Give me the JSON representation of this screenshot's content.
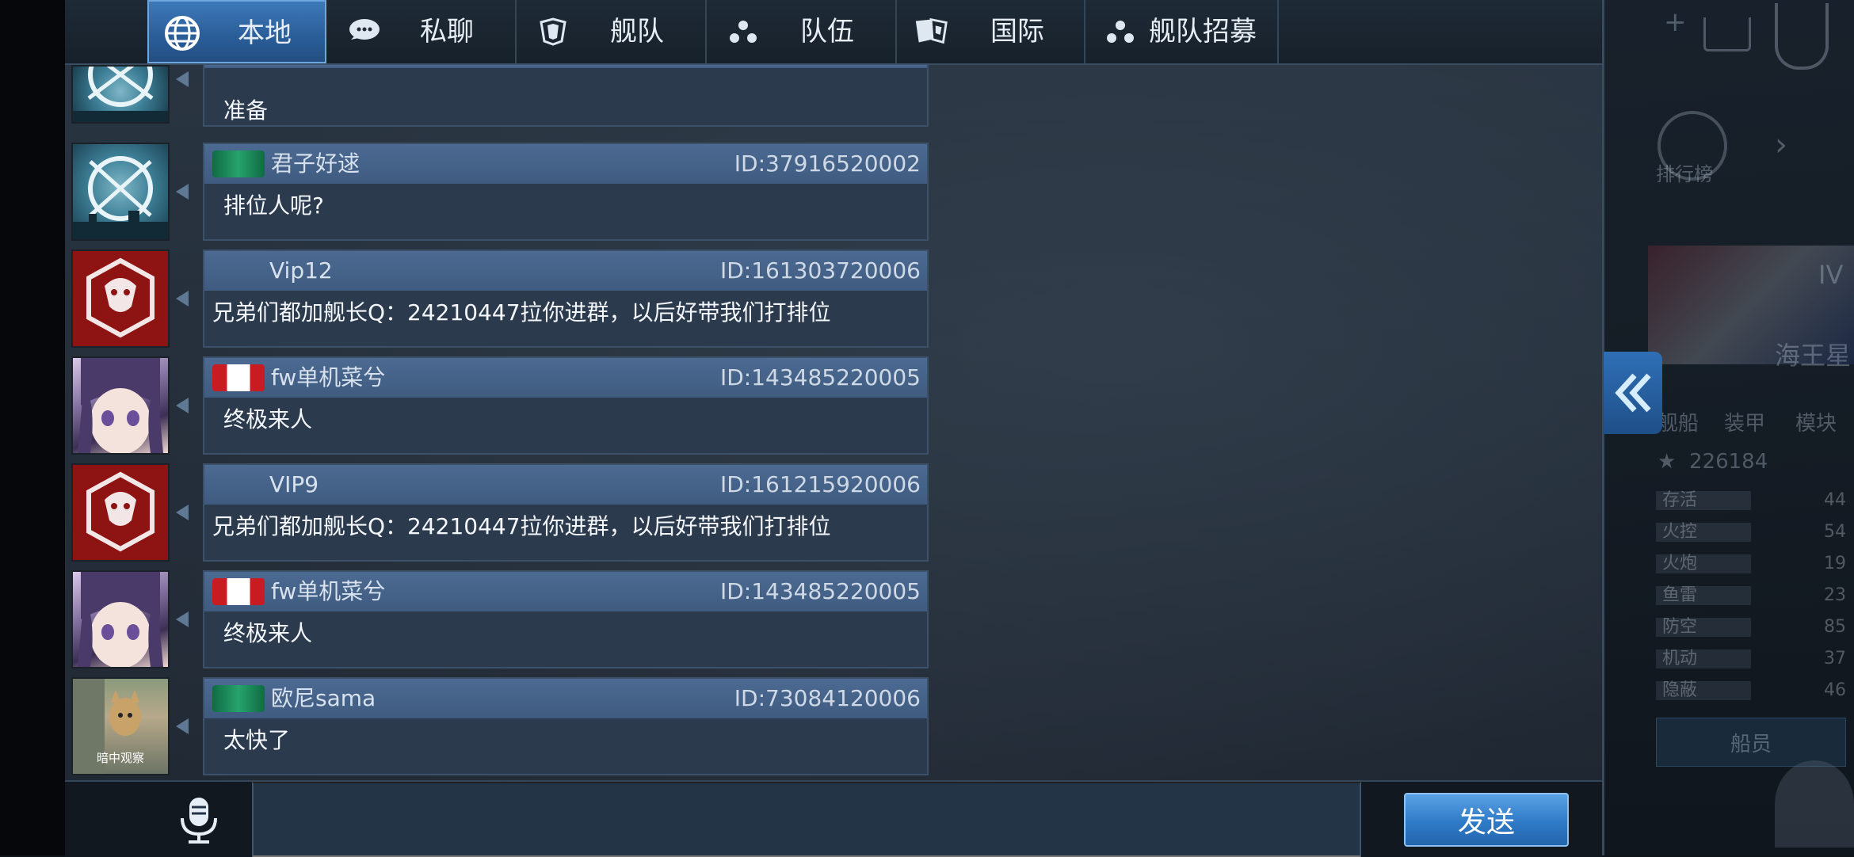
{
  "tabs": [
    {
      "label": "本地",
      "icon": "globe-icon",
      "active": true
    },
    {
      "label": "私聊",
      "icon": "chat-bubble-icon",
      "active": false
    },
    {
      "label": "舰队",
      "icon": "fleet-icon",
      "active": false
    },
    {
      "label": "队伍",
      "icon": "team-icon",
      "active": false
    },
    {
      "label": "国际",
      "icon": "flags-icon",
      "active": false
    },
    {
      "label": "舰队招募",
      "icon": "team-icon",
      "active": false
    }
  ],
  "messages": [
    {
      "name": "",
      "id": "",
      "text": "准备",
      "avatar": "naval-emblem",
      "flag": ""
    },
    {
      "name": "君子好逑",
      "id": "ID:37916520002",
      "text": "排位人呢?",
      "avatar": "naval-emblem",
      "flag": "green"
    },
    {
      "name": "Vip12",
      "id": "ID:161303720006",
      "text": "兄弟们都加舰长Q：24210447拉你进群，以后好带我们打排位",
      "avatar": "dragon-emblem",
      "flag": ""
    },
    {
      "name": "fw单机菜兮",
      "id": "ID:143485220005",
      "text": "终极来人",
      "avatar": "anime-girl",
      "flag": "canada"
    },
    {
      "name": "VIP9",
      "id": "ID:161215920006",
      "text": "兄弟们都加舰长Q：24210447拉你进群，以后好带我们打排位",
      "avatar": "dragon-emblem",
      "flag": ""
    },
    {
      "name": "fw单机菜兮",
      "id": "ID:143485220005",
      "text": "终极来人",
      "avatar": "anime-girl",
      "flag": "canada"
    },
    {
      "name": "欧尼sama",
      "id": "ID:73084120006",
      "text": "太快了",
      "avatar": "dog-photo",
      "avatar_caption": "暗中观察",
      "flag": "green"
    }
  ],
  "input": {
    "value": "",
    "placeholder": ""
  },
  "send_label": "发送",
  "side": {
    "ranking_label": "排行榜",
    "tier": "IV",
    "ship_name": "海王星",
    "tabs": [
      "舰船",
      "装甲",
      "模块"
    ],
    "rating": "226184",
    "stats": [
      {
        "name": "存活",
        "value": "44"
      },
      {
        "name": "火控",
        "value": "54"
      },
      {
        "name": "火炮",
        "value": "19"
      },
      {
        "name": "鱼雷",
        "value": "23"
      },
      {
        "name": "防空",
        "value": "85"
      },
      {
        "name": "机动",
        "value": "37"
      },
      {
        "name": "隐蔽",
        "value": "46"
      }
    ],
    "crew_label": "船员"
  },
  "colors": {
    "accent": "#2f7ac7",
    "bubble_head": "#4c6a92",
    "bubble_body": "#2b3a4c"
  }
}
